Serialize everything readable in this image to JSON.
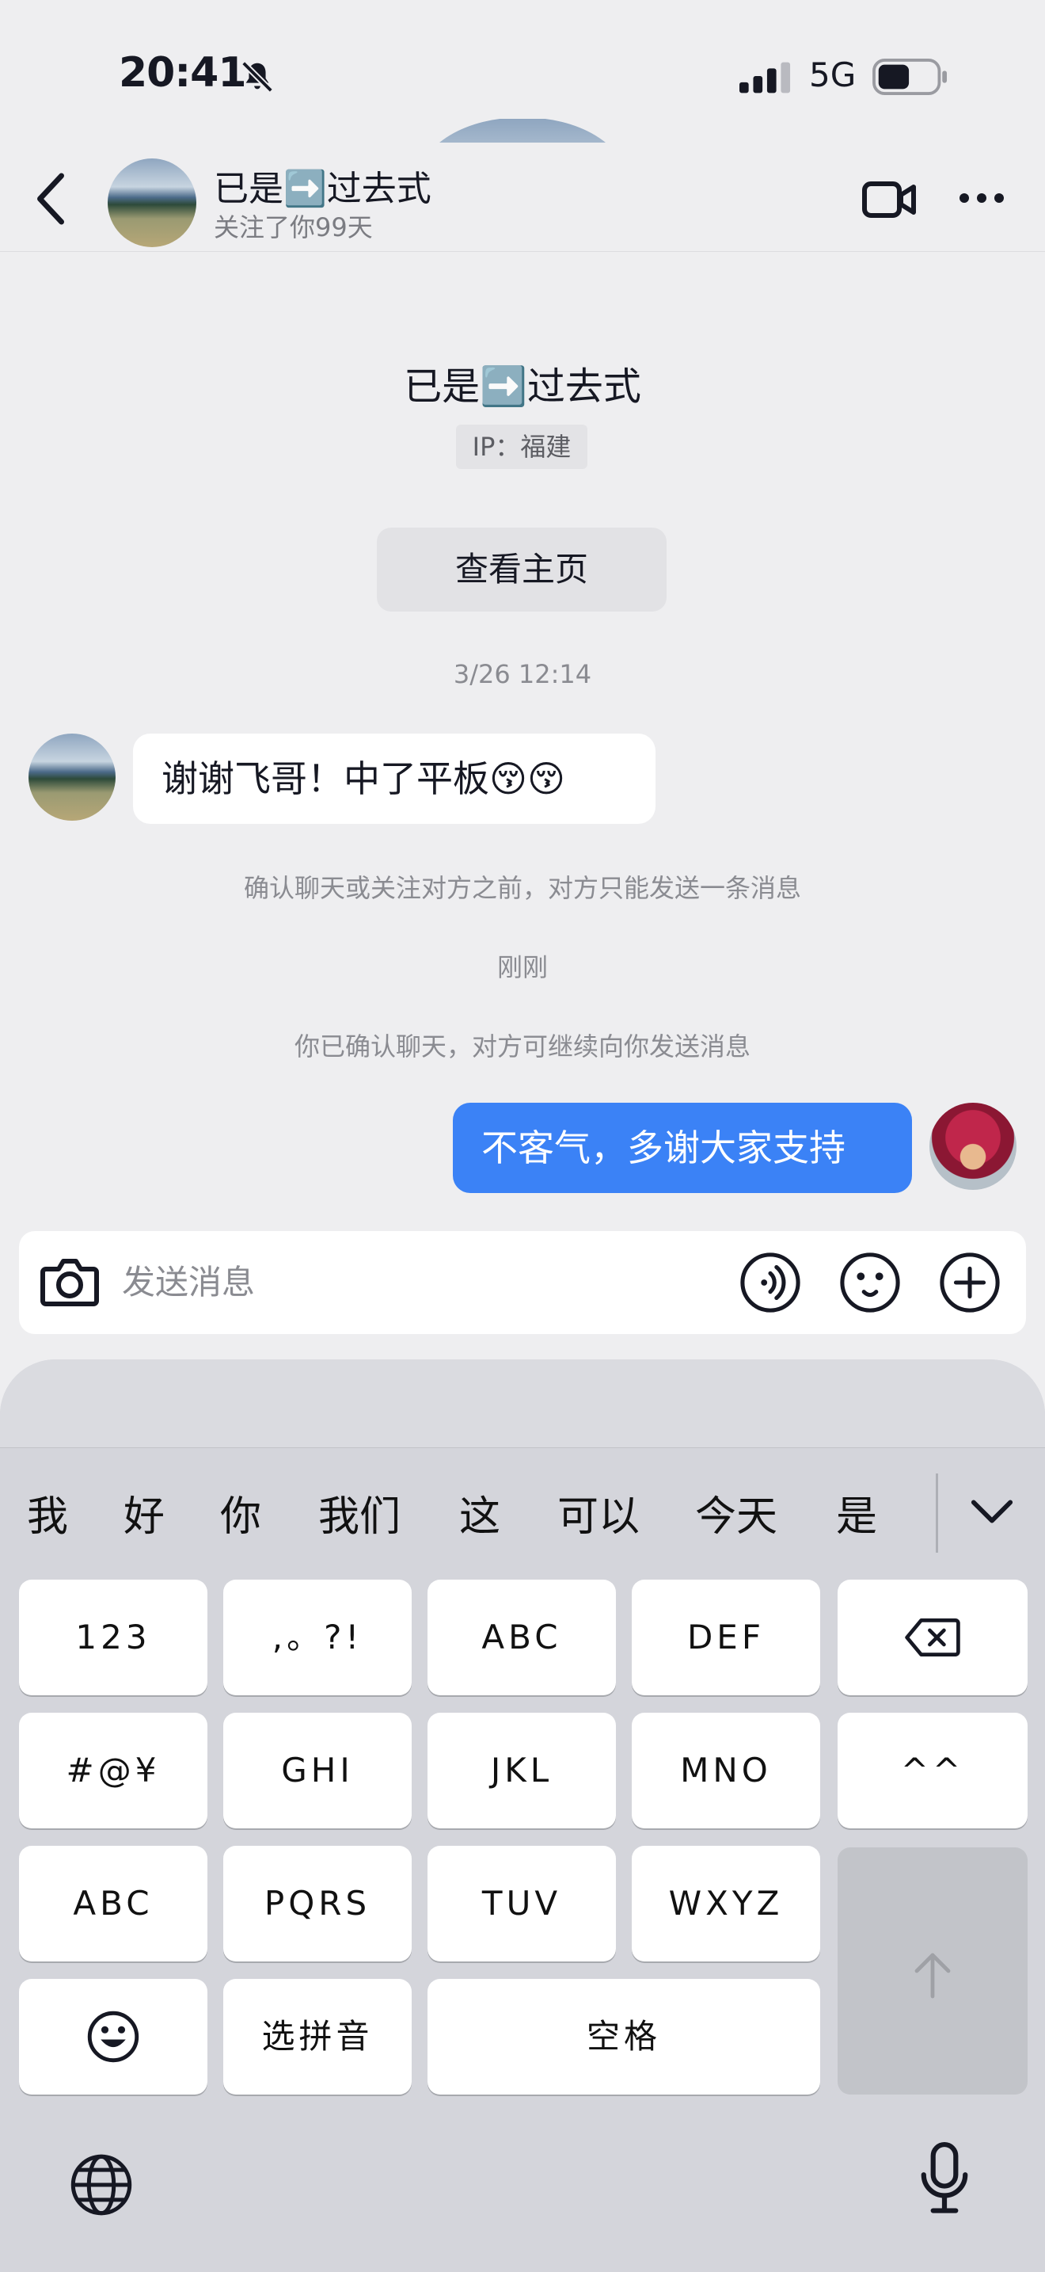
{
  "status_bar": {
    "time": "20:41",
    "network": "5G"
  },
  "header": {
    "name": "已是➡️过去式",
    "subtitle": "关注了你99天"
  },
  "profile": {
    "name": "已是➡️过去式",
    "ip_label": "IP：福建",
    "view_button": "查看主页"
  },
  "chat": {
    "timestamp_1": "3/26 12:14",
    "incoming_message": "谢谢飞哥！中了平板😚😚",
    "system_notice_1": "确认聊天或关注对方之前，对方只能发送一条消息",
    "timestamp_2": "刚刚",
    "system_notice_2": "你已确认聊天，对方可继续向你发送消息",
    "outgoing_message": "不客气，多谢大家支持"
  },
  "input": {
    "placeholder": "发送消息"
  },
  "keyboard": {
    "candidates": [
      "我",
      "好",
      "你",
      "我们",
      "这",
      "可以",
      "今天",
      "是"
    ],
    "rows": [
      [
        "123",
        ",。?!",
        "ABC",
        "DEF"
      ],
      [
        "#@¥",
        "GHI",
        "JKL",
        "MNO",
        "^^"
      ],
      [
        "ABC",
        "PQRS",
        "TUV",
        "WXYZ"
      ],
      [
        "选拼音",
        "空格"
      ]
    ]
  },
  "colors": {
    "accent": "#3b82f6",
    "background": "#eeeef0",
    "keyboard": "#d4d5db"
  },
  "icons": [
    "bell-mute-icon",
    "signal-icon",
    "battery-icon",
    "back-icon",
    "video-icon",
    "more-icon",
    "camera-icon",
    "voice-icon",
    "emoji-icon",
    "plus-icon",
    "backspace-icon",
    "emoji-key-icon",
    "enter-arrow-icon",
    "globe-icon",
    "mic-icon",
    "chevron-down-icon"
  ]
}
